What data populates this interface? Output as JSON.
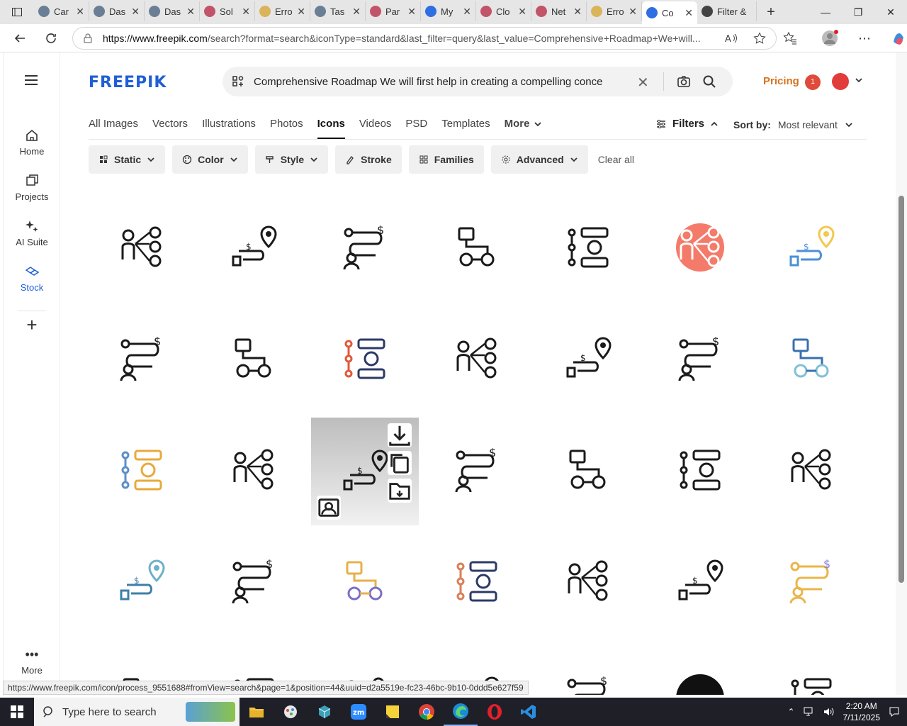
{
  "browser": {
    "tabs": [
      {
        "title": "Car",
        "color": "#6a7f95"
      },
      {
        "title": "Das",
        "color": "#6a7f95"
      },
      {
        "title": "Das",
        "color": "#6a7f95"
      },
      {
        "title": "Sol",
        "color": "#c2546a"
      },
      {
        "title": "Erro",
        "color": "#d9b45a"
      },
      {
        "title": "Tas",
        "color": "#6a7f95"
      },
      {
        "title": "Par",
        "color": "#c2546a"
      },
      {
        "title": "My",
        "color": "#2e6ee0"
      },
      {
        "title": "Clo",
        "color": "#c2546a"
      },
      {
        "title": "Net",
        "color": "#c2546a"
      },
      {
        "title": "Erro",
        "color": "#d9b45a"
      },
      {
        "title": "Co",
        "color": "#2e6ee0",
        "active": true
      },
      {
        "title": "Filter &",
        "color": "#444444"
      }
    ],
    "url_host": "https://www.freepik.com",
    "url_path": "/search?format=search&iconType=standard&last_filter=query&last_value=Comprehensive+Roadmap+We+will...",
    "status_url": "https://www.freepik.com/icon/process_9551688#fromView=search&page=1&position=44&uuid=d2a5519e-fc23-46bc-9b10-0ddd5e627f59"
  },
  "sidebar": {
    "items": [
      {
        "label": "Home",
        "icon": "home-icon"
      },
      {
        "label": "Projects",
        "icon": "projects-icon"
      },
      {
        "label": "AI Suite",
        "icon": "sparkle-icon"
      },
      {
        "label": "Stock",
        "icon": "stock-icon",
        "active": true
      }
    ],
    "more_label": "More"
  },
  "header": {
    "logo": "FREEPIK",
    "search_value": "Comprehensive Roadmap We will first help in creating a compelling conce",
    "pricing": "Pricing",
    "notif_count": "1"
  },
  "type_tabs": [
    "All Images",
    "Vectors",
    "Illustrations",
    "Photos",
    "Icons",
    "Videos",
    "PSD",
    "Templates",
    "More"
  ],
  "active_tab": "Icons",
  "filters_label": "Filters",
  "sort": {
    "label": "Sort by:",
    "value": "Most relevant"
  },
  "chips": [
    "Static",
    "Color",
    "Style",
    "Stroke",
    "Families",
    "Advanced"
  ],
  "clear_all": "Clear all",
  "taskbar": {
    "search_placeholder": "Type here to search",
    "time": "2:20 AM",
    "date": "7/11/2025"
  },
  "colors": {
    "accent": "#1f5fd6",
    "pricing": "#d4741f",
    "highlight_tile": "#f47b6a"
  }
}
